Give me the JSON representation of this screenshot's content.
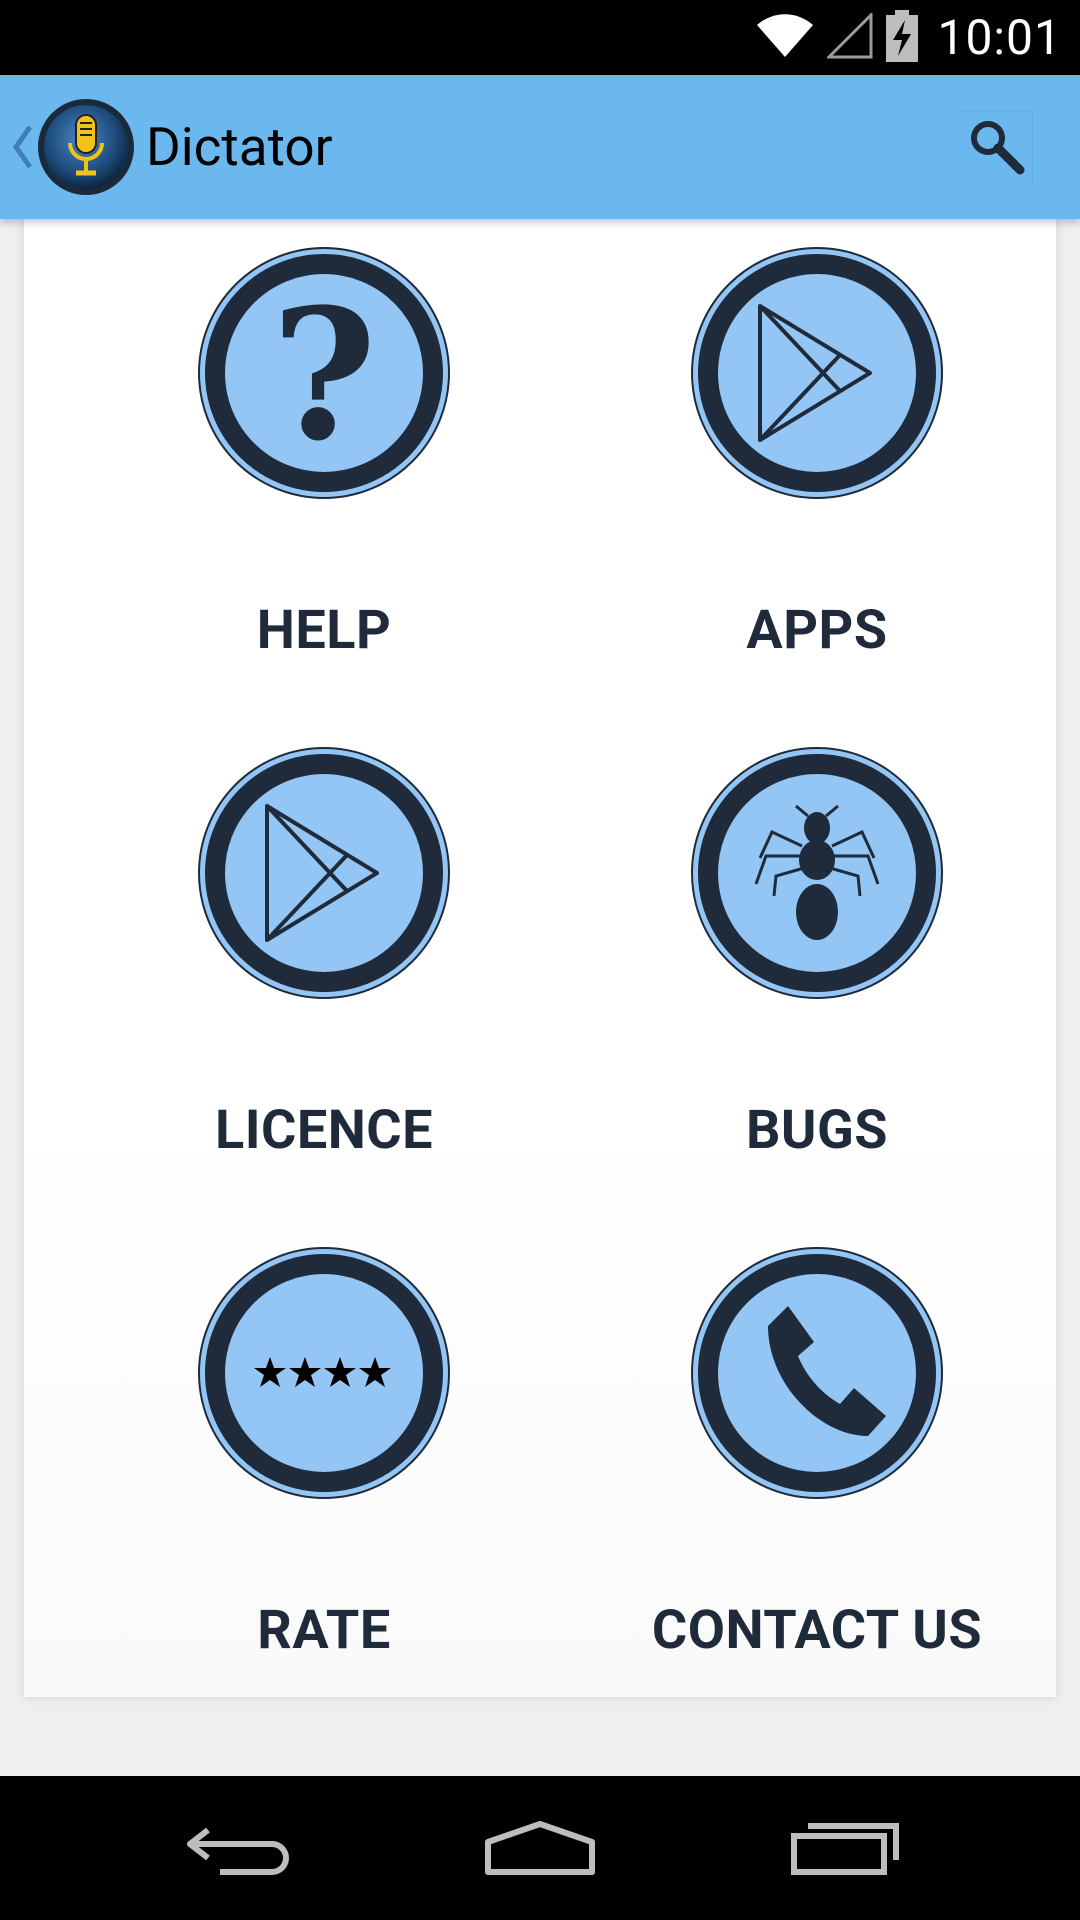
{
  "status_bar": {
    "time": "10:01"
  },
  "action_bar": {
    "title": "Dictator"
  },
  "menu": [
    {
      "key": "help",
      "label": "HELP",
      "icon": "question-icon"
    },
    {
      "key": "apps",
      "label": "APPS",
      "icon": "play-store-icon"
    },
    {
      "key": "licence",
      "label": "LICENCE",
      "icon": "play-store-icon"
    },
    {
      "key": "bugs",
      "label": "BUGS",
      "icon": "bug-icon"
    },
    {
      "key": "rate",
      "label": "RATE",
      "icon": "stars-icon"
    },
    {
      "key": "contact",
      "label": "CONTACT US",
      "icon": "phone-icon"
    }
  ],
  "colors": {
    "action_bar": "#6bb8ef",
    "icon_fill": "#93c6f4",
    "icon_ring": "#1f2b3a",
    "label": "#1f2b3a"
  }
}
